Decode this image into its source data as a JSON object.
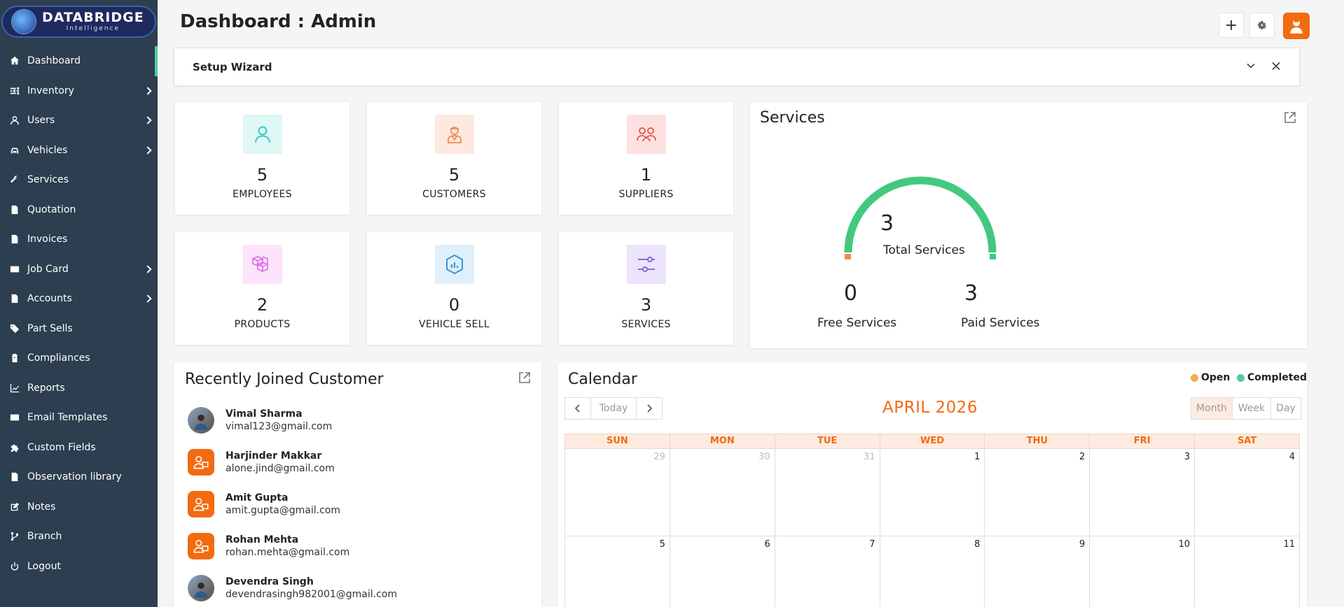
{
  "logo": {
    "main": "DATABRIDGE",
    "sub": "Intelligence"
  },
  "sidebar": {
    "items": [
      {
        "label": "Dashboard",
        "icon": "home-icon",
        "active": true,
        "submenu": false
      },
      {
        "label": "Inventory",
        "icon": "sliders-icon",
        "submenu": true
      },
      {
        "label": "Users",
        "icon": "user-icon",
        "submenu": true
      },
      {
        "label": "Vehicles",
        "icon": "car-icon",
        "submenu": true
      },
      {
        "label": "Services",
        "icon": "wrench-icon",
        "submenu": false
      },
      {
        "label": "Quotation",
        "icon": "document-icon",
        "submenu": false
      },
      {
        "label": "Invoices",
        "icon": "document-icon",
        "submenu": false
      },
      {
        "label": "Job Card",
        "icon": "card-icon",
        "submenu": true
      },
      {
        "label": "Accounts",
        "icon": "document-icon",
        "submenu": true
      },
      {
        "label": "Part Sells",
        "icon": "tag-icon",
        "submenu": false
      },
      {
        "label": "Compliances",
        "icon": "clipboard-icon",
        "submenu": false
      },
      {
        "label": "Reports",
        "icon": "chart-icon",
        "submenu": false
      },
      {
        "label": "Email Templates",
        "icon": "email-icon",
        "submenu": false
      },
      {
        "label": "Custom Fields",
        "icon": "puzzle-icon",
        "submenu": false
      },
      {
        "label": "Observation library",
        "icon": "document-icon",
        "submenu": false
      },
      {
        "label": "Notes",
        "icon": "edit-icon",
        "submenu": false
      },
      {
        "label": "Branch",
        "icon": "branch-icon",
        "submenu": false
      },
      {
        "label": "Logout",
        "icon": "power-icon",
        "submenu": false
      }
    ]
  },
  "header": {
    "title": "Dashboard : Admin",
    "add_label": "+"
  },
  "wizard": {
    "title": "Setup Wizard"
  },
  "stats": [
    {
      "value": "5",
      "label": "EMPLOYEES",
      "icon": "user-icon",
      "bg": "#dff7f5",
      "color": "#3ccbc0"
    },
    {
      "value": "5",
      "label": "CUSTOMERS",
      "icon": "customer-icon",
      "bg": "#fde9df",
      "color": "#f28a4e"
    },
    {
      "value": "1",
      "label": "SUPPLIERS",
      "icon": "group-icon",
      "bg": "#fde1e0",
      "color": "#e8504a"
    },
    {
      "value": "2",
      "label": "PRODUCTS",
      "icon": "boxes-icon",
      "bg": "#fde3fb",
      "color": "#d46fe0"
    },
    {
      "value": "0",
      "label": "VEHICLE SELL",
      "icon": "hexagon-chart-icon",
      "bg": "#dff0fb",
      "color": "#3a95d4"
    },
    {
      "value": "3",
      "label": "SERVICES",
      "icon": "sliders-icon",
      "bg": "#ebe4fb",
      "color": "#8a68d8"
    }
  ],
  "services": {
    "title": "Services",
    "total": "3",
    "total_label": "Total Services",
    "free": "0",
    "free_label": "Free Services",
    "paid": "3",
    "paid_label": "Paid Services",
    "gauge_fraction": 1.0,
    "free_color": "#f5894a",
    "paid_color": "#43c97f"
  },
  "recent": {
    "title": "Recently Joined Customer",
    "customers": [
      {
        "name": "Vimal Sharma",
        "email": "vimal123@gmail.com",
        "avatar": "photo"
      },
      {
        "name": "Harjinder Makkar",
        "email": "alone.jind@gmail.com",
        "avatar": "default"
      },
      {
        "name": "Amit Gupta",
        "email": "amit.gupta@gmail.com",
        "avatar": "default"
      },
      {
        "name": "Rohan Mehta",
        "email": "rohan.mehta@gmail.com",
        "avatar": "default"
      },
      {
        "name": "Devendra Singh",
        "email": "devendrasingh982001@gmail.com",
        "avatar": "photo"
      }
    ]
  },
  "calendar": {
    "title": "Calendar",
    "legend_open": "Open",
    "legend_completed": "Completed",
    "open_color": "#f0ad4e",
    "completed_color": "#4ecda0",
    "today_label": "Today",
    "month_label": "APRIL 2026",
    "views": [
      "Month",
      "Week",
      "Day"
    ],
    "weekdays": [
      "SUN",
      "MON",
      "TUE",
      "WED",
      "THU",
      "FRI",
      "SAT"
    ],
    "weeks": [
      [
        {
          "d": "29",
          "dim": true
        },
        {
          "d": "30",
          "dim": true
        },
        {
          "d": "31",
          "dim": true
        },
        {
          "d": "1"
        },
        {
          "d": "2"
        },
        {
          "d": "3"
        },
        {
          "d": "4"
        }
      ],
      [
        {
          "d": "5"
        },
        {
          "d": "6"
        },
        {
          "d": "7"
        },
        {
          "d": "8"
        },
        {
          "d": "9"
        },
        {
          "d": "10"
        },
        {
          "d": "11"
        }
      ]
    ]
  }
}
